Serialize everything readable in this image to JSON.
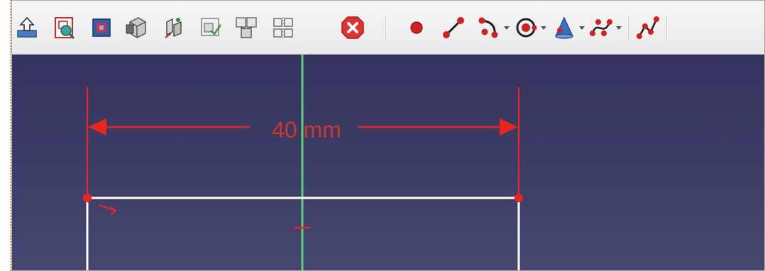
{
  "toolbar": {
    "icons": [
      "leave-sketch-icon",
      "view-sketch-icon",
      "view-section-icon",
      "map-sketch-icon",
      "reorient-sketch-icon",
      "validate-sketch-icon",
      "merge-sketches-icon",
      "mirror-sketch-icon",
      "stop-operation-icon",
      "point-icon",
      "line-icon",
      "arc-icon",
      "circle-icon",
      "conic-icon",
      "bspline-icon",
      "polyline-icon"
    ]
  },
  "sketch": {
    "dimension_label": "40 mm"
  },
  "colors": {
    "viewport_top": "#34335f",
    "viewport_bottom": "#44476f",
    "dimension": "#e8261c",
    "geometry": "#ffffff",
    "vertical_axis": "#5fcf78",
    "stop_icon": "#e33030"
  }
}
